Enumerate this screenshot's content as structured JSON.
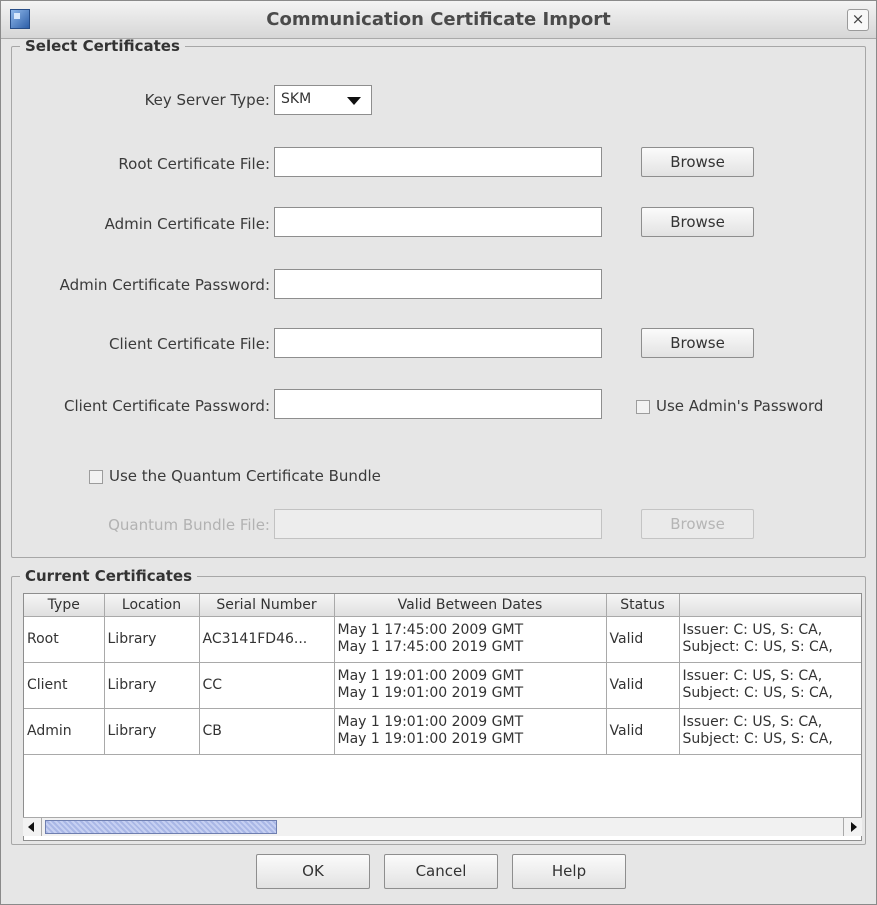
{
  "window": {
    "title": "Communication Certificate Import",
    "close_label": "×"
  },
  "select_certificates": {
    "legend": "Select Certificates",
    "key_server_type_label": "Key Server Type:",
    "key_server_type_value": "SKM",
    "root_certificate_label": "Root Certificate File:",
    "root_certificate_value": "",
    "admin_certificate_label": "Admin Certificate File:",
    "admin_certificate_value": "",
    "admin_password_label": "Admin Certificate Password:",
    "admin_password_value": "",
    "client_certificate_label": "Client Certificate File:",
    "client_certificate_value": "",
    "client_password_label": "Client Certificate Password:",
    "client_password_value": "",
    "use_admin_password_label": "Use Admin's Password",
    "use_admin_password_checked": false,
    "use_quantum_bundle_label": "Use the Quantum Certificate Bundle",
    "use_quantum_bundle_checked": false,
    "quantum_bundle_label": "Quantum Bundle File:",
    "quantum_bundle_value": "",
    "browse_label": "Browse"
  },
  "current_certificates": {
    "legend": "Current Certificates",
    "columns": [
      "Type",
      "Location",
      "Serial Number",
      "Valid Between Dates",
      "Status",
      ""
    ],
    "rows": [
      {
        "type": "Root",
        "location": "Library",
        "serial": "AC3141FD46...",
        "valid_from": "May  1 17:45:00 2009 GMT",
        "valid_to": "May  1 17:45:00 2019 GMT",
        "status": "Valid",
        "issuer": "Issuer:  C: US, S: CA,",
        "subject": "Subject: C: US, S: CA,"
      },
      {
        "type": "Client",
        "location": "Library",
        "serial": "CC",
        "valid_from": "May  1 19:01:00 2009 GMT",
        "valid_to": "May  1 19:01:00 2019 GMT",
        "status": "Valid",
        "issuer": "Issuer:  C: US, S: CA,",
        "subject": "Subject: C: US, S: CA,"
      },
      {
        "type": "Admin",
        "location": "Library",
        "serial": "CB",
        "valid_from": "May  1 19:01:00 2009 GMT",
        "valid_to": "May  1 19:01:00 2019 GMT",
        "status": "Valid",
        "issuer": "Issuer:  C: US, S: CA,",
        "subject": "Subject: C: US, S: CA,"
      }
    ],
    "status_color": "#3a9b22"
  },
  "buttons": {
    "ok": "OK",
    "cancel": "Cancel",
    "help": "Help"
  }
}
